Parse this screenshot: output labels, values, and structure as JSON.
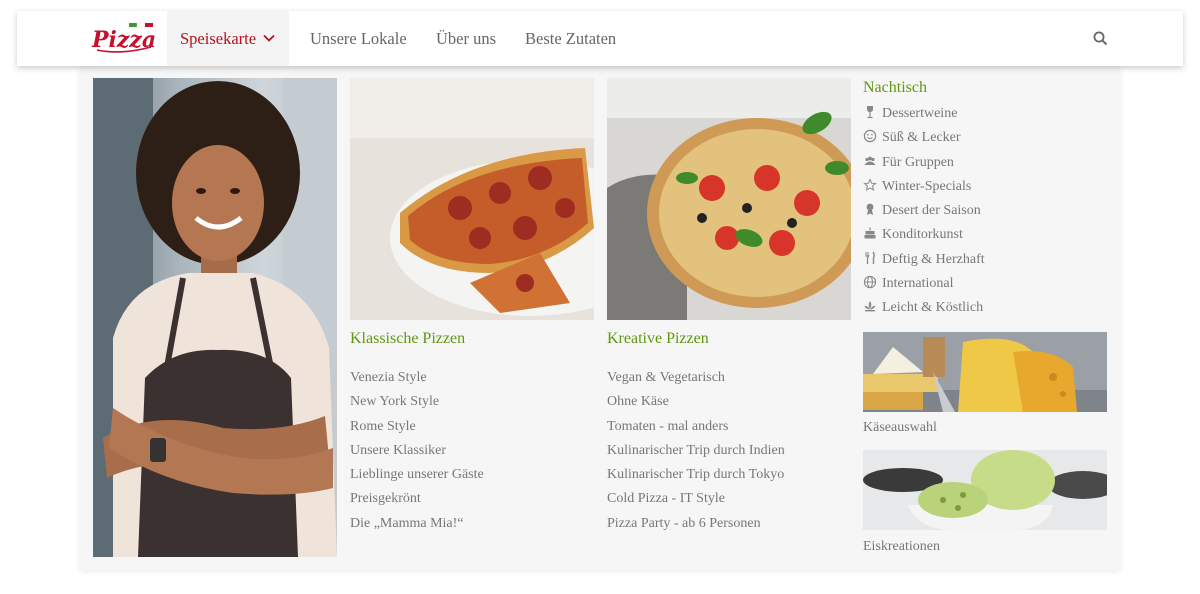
{
  "brand": {
    "logo_text": "Pizza"
  },
  "nav": {
    "items": [
      {
        "label": "Speisekarte",
        "active": true
      },
      {
        "label": "Unsere Lokale"
      },
      {
        "label": "Über uns"
      },
      {
        "label": "Beste Zutaten"
      }
    ],
    "search_icon": "search-icon"
  },
  "mega_menu": {
    "classic": {
      "title": "Klassische Pizzen",
      "links": [
        "Venezia Style",
        "New York Style",
        "Rome Style",
        "Unsere Klassiker",
        "Lieblinge unserer Gäste",
        "Preisgekrönt",
        "Die „Mamma Mia!“"
      ]
    },
    "creative": {
      "title": "Kreative Pizzen",
      "links": [
        "Vegan & Vegetarisch",
        "Ohne Käse",
        "Tomaten - mal anders",
        "Kulinarischer Trip durch Indien",
        "Kulinarischer Trip durch Tokyo",
        "Cold Pizza - IT Style",
        "Pizza Party - ab 6 Personen"
      ]
    },
    "dessert": {
      "title": "Nachtisch",
      "links": [
        {
          "label": "Dessertweine",
          "icon": "wine-glass-icon"
        },
        {
          "label": "Süß & Lecker",
          "icon": "smiley-icon"
        },
        {
          "label": "Für Gruppen",
          "icon": "group-icon"
        },
        {
          "label": "Winter-Specials",
          "icon": "star-icon"
        },
        {
          "label": "Desert der Saison",
          "icon": "award-icon"
        },
        {
          "label": "Konditorkunst",
          "icon": "cake-icon"
        },
        {
          "label": "Deftig & Herzhaft",
          "icon": "cutlery-icon"
        },
        {
          "label": "International",
          "icon": "globe-icon"
        },
        {
          "label": "Leicht & Köstlich",
          "icon": "lotus-icon"
        }
      ]
    },
    "tiles": [
      {
        "label": "Käseauswahl"
      },
      {
        "label": "Eiskreationen"
      }
    ]
  },
  "colors": {
    "accent_red": "#b5121b",
    "accent_green": "#5e9812",
    "panel_bg": "#f6f6f6"
  }
}
